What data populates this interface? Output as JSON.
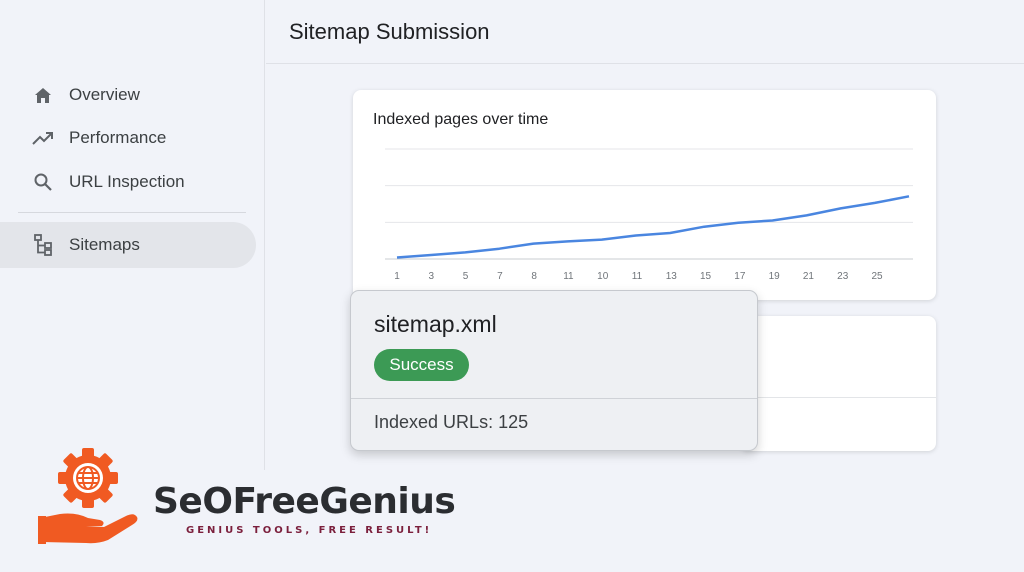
{
  "sidebar": {
    "items": [
      {
        "label": "Overview",
        "icon": "home-icon"
      },
      {
        "label": "Performance",
        "icon": "trending-up-icon"
      },
      {
        "label": "URL Inspection",
        "icon": "search-icon"
      },
      {
        "label": "Sitemaps",
        "icon": "sitemap-icon",
        "active": true
      }
    ]
  },
  "header": {
    "title": "Sitemap Submission"
  },
  "chart_data": {
    "type": "line",
    "title": "Indexed pages over time",
    "xlabel": "",
    "ylabel": "",
    "x_tick_labels": [
      "1",
      "3",
      "5",
      "7",
      "8",
      "11",
      "10",
      "11",
      "13",
      "15",
      "17",
      "19",
      "21",
      "23",
      "25"
    ],
    "series": [
      {
        "values": [
          0.04,
          0.11,
          0.18,
          0.28,
          0.42,
          0.48,
          0.53,
          0.64,
          0.71,
          0.88,
          0.99,
          1.05,
          1.19,
          1.38,
          1.53,
          1.71
        ],
        "color": "#4a86e0"
      }
    ],
    "ylim": [
      0,
      3
    ],
    "grid": true,
    "legend": "none"
  },
  "popup": {
    "filename": "sitemap.xml",
    "status": "Success",
    "status_color": "#3c9a55",
    "indexed_label": "Indexed URLs: 125"
  },
  "brand": {
    "name": "SeOFreeGenius",
    "tagline": "GENIUS TOOLS, FREE RESULT!",
    "colors": {
      "primary": "#f05a22",
      "text": "#2b2d31",
      "tagline": "#7b1f3c"
    }
  }
}
